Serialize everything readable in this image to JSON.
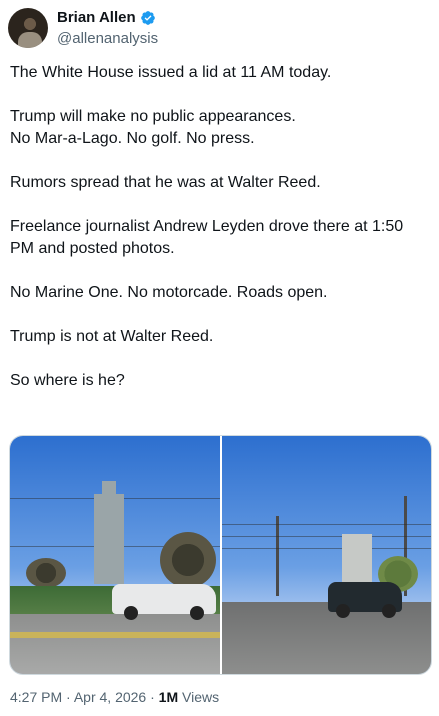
{
  "author": {
    "display_name": "Brian Allen",
    "handle": "@allenanalysis",
    "verified": true,
    "verified_icon": "verified-badge-icon",
    "verified_color": "#1d9bf0"
  },
  "tweet": {
    "paragraphs": [
      "The White House issued a lid at 11 AM today.",
      "Trump will make no public appearances.\nNo Mar-a-Lago. No golf. No press.",
      "Rumors spread that he was at Walter Reed.",
      "Freelance journalist Andrew Leyden drove there at 1:50 PM and posted photos.",
      "No Marine One. No motorcade. Roads open.",
      "Trump is not at Walter Reed.",
      "So where is he?"
    ]
  },
  "media": {
    "photo_count": 2
  },
  "meta": {
    "time": "4:27 PM",
    "separator": "·",
    "date": "Apr 4, 2026",
    "views_count": "1M",
    "views_label": "Views"
  },
  "colors": {
    "text": "#0f1419",
    "secondary": "#536471",
    "accent": "#1d9bf0"
  }
}
